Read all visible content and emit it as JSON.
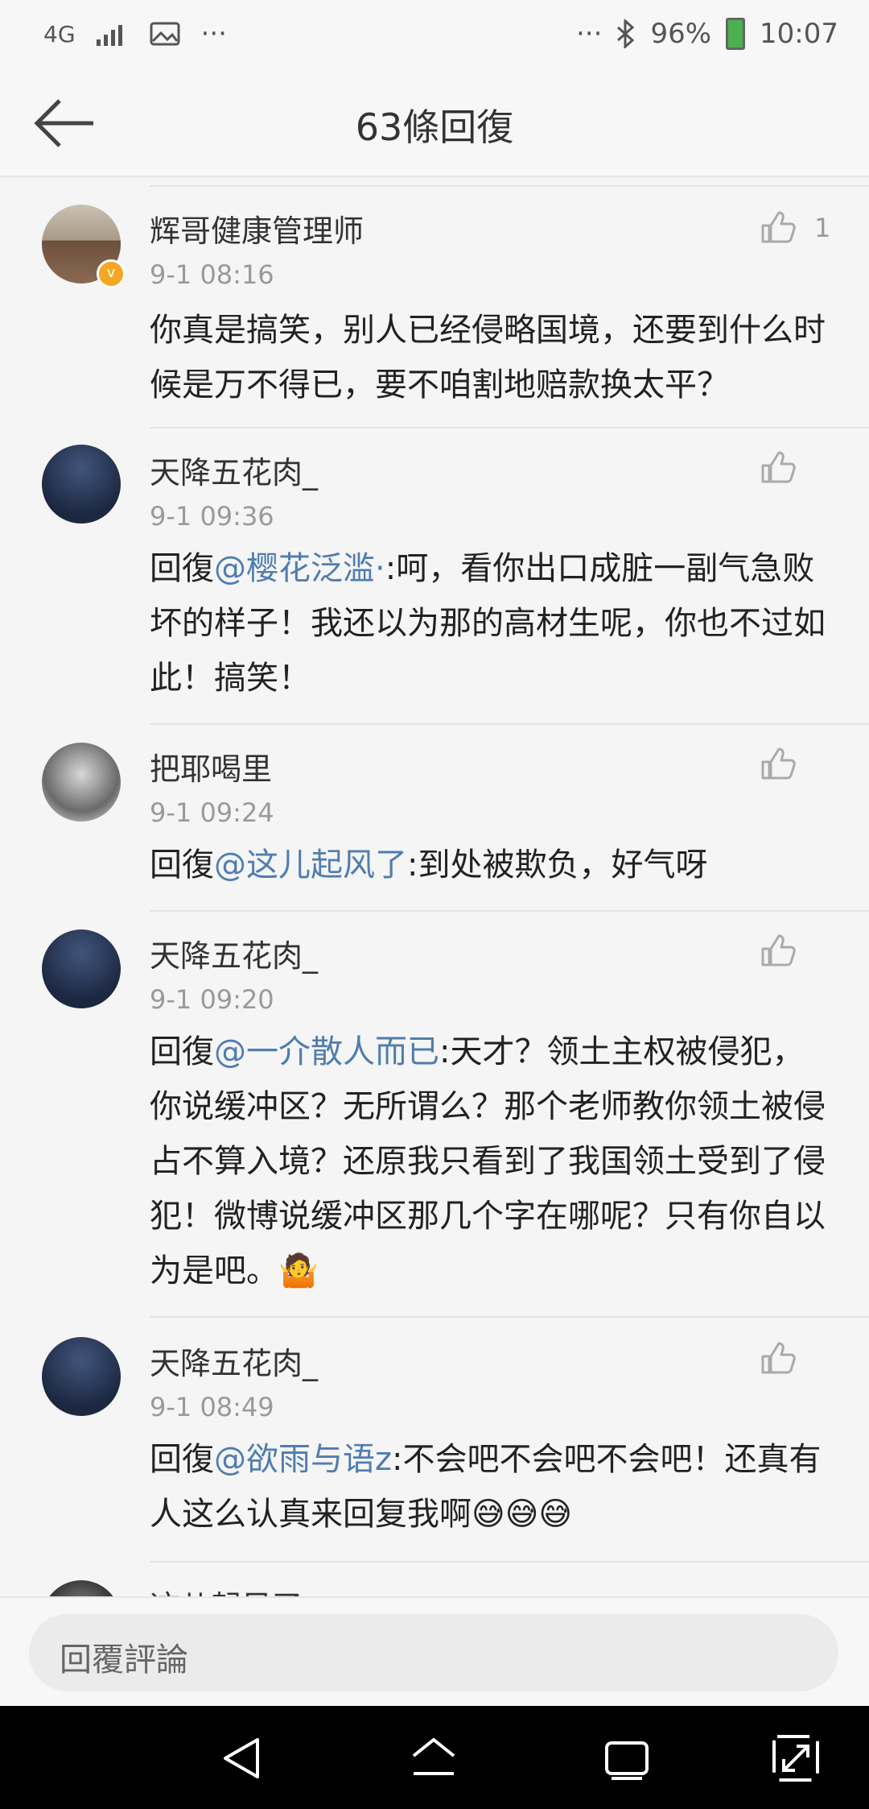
{
  "status_bar": {
    "network": "4G",
    "signal_icon": "signal-bars-icon",
    "image_icon": "image-icon",
    "more_left": "···",
    "more_right": "···",
    "bluetooth_icon": "bluetooth-icon",
    "battery": "96%",
    "time": "10:07"
  },
  "app_bar": {
    "title": "63條回復",
    "back_icon": "back-arrow-icon"
  },
  "comments": [
    {
      "user": "辉哥健康管理师",
      "time": "9-1 08:16",
      "like_count": "1",
      "text": "你真是搞笑，别人已经侵略国境，还要到什么时候是万不得已，要不咱割地赔款换太平？"
    },
    {
      "user": "天降五花肉_",
      "time": "9-1 09:36",
      "prefix": "回復",
      "mention": "@樱花泛滥·",
      "text": ":呵，看你出口成脏一副气急败坏的样子！我还以为那的高材生呢，你也不过如此！搞笑！"
    },
    {
      "user": "把耶喝里",
      "time": "9-1 09:24",
      "prefix": "回復",
      "mention": "@这儿起风了",
      "text": ":到处被欺负，好气呀"
    },
    {
      "user": "天降五花肉_",
      "time": "9-1 09:20",
      "prefix": "回復",
      "mention": "@一介散人而已",
      "text": ":天才？领土主权被侵犯，你说缓冲区？无所谓么？那个老师教你领土被侵占不算入境？还原我只看到了我国领土受到了侵犯！微博说缓冲区那几个字在哪呢？只有你自以为是吧。🤷"
    },
    {
      "user": "天降五花肉_",
      "time": "9-1 08:49",
      "prefix": "回復",
      "mention": "@欲雨与语z",
      "text": ":不会吧不会吧不会吧！还真有人这么认真来回复我啊😅😅😅"
    }
  ],
  "partial_comment": {
    "user": "这儿起风了"
  },
  "input": {
    "placeholder": "回覆評論"
  },
  "nav": {
    "back": "nav-back-icon",
    "home": "nav-home-icon",
    "recents": "nav-recents-icon",
    "expand": "nav-expand-icon"
  },
  "colors": {
    "mention": "#507daf",
    "background": "#f5f5f5",
    "time": "#9a9a9a"
  }
}
